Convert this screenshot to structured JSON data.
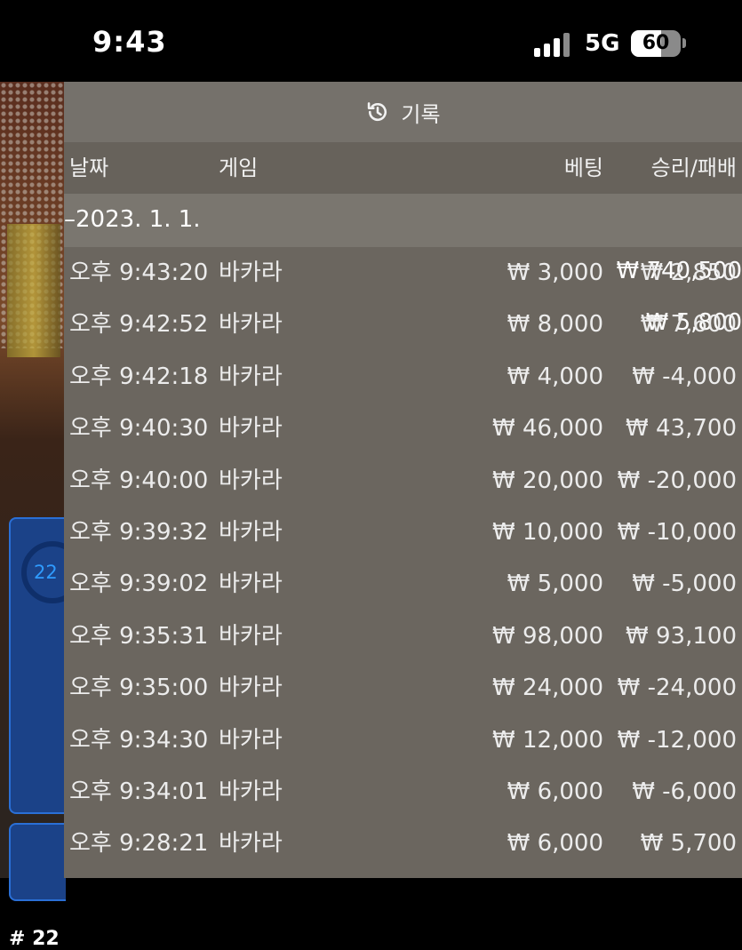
{
  "status_bar": {
    "time": "9:43",
    "network": "5G",
    "battery": "60",
    "battery_level": 0.6
  },
  "background_game": {
    "progress_text": "22",
    "table_number": "# 22"
  },
  "history": {
    "title": "기록",
    "columns": {
      "date": "날짜",
      "game": "게임",
      "bet": "베팅",
      "win_loss": "승리/패배"
    },
    "summary": {
      "date": "–2023. 1. 1.",
      "bet": "₩ 740,500",
      "win_loss": "₩ 5,800"
    },
    "rows": [
      {
        "time": "오후 9:43:20",
        "game": "바카라",
        "bet": "₩ 3,000",
        "win_loss": "₩ 2,850"
      },
      {
        "time": "오후 9:42:52",
        "game": "바카라",
        "bet": "₩ 8,000",
        "win_loss": "₩ 7,600"
      },
      {
        "time": "오후 9:42:18",
        "game": "바카라",
        "bet": "₩ 4,000",
        "win_loss": "₩ -4,000"
      },
      {
        "time": "오후 9:40:30",
        "game": "바카라",
        "bet": "₩ 46,000",
        "win_loss": "₩ 43,700"
      },
      {
        "time": "오후 9:40:00",
        "game": "바카라",
        "bet": "₩ 20,000",
        "win_loss": "₩ -20,000"
      },
      {
        "time": "오후 9:39:32",
        "game": "바카라",
        "bet": "₩ 10,000",
        "win_loss": "₩ -10,000"
      },
      {
        "time": "오후 9:39:02",
        "game": "바카라",
        "bet": "₩ 5,000",
        "win_loss": "₩ -5,000"
      },
      {
        "time": "오후 9:35:31",
        "game": "바카라",
        "bet": "₩ 98,000",
        "win_loss": "₩ 93,100"
      },
      {
        "time": "오후 9:35:00",
        "game": "바카라",
        "bet": "₩ 24,000",
        "win_loss": "₩ -24,000"
      },
      {
        "time": "오후 9:34:30",
        "game": "바카라",
        "bet": "₩ 12,000",
        "win_loss": "₩ -12,000"
      },
      {
        "time": "오후 9:34:01",
        "game": "바카라",
        "bet": "₩ 6,000",
        "win_loss": "₩ -6,000"
      },
      {
        "time": "오후 9:28:21",
        "game": "바카라",
        "bet": "₩ 6,000",
        "win_loss": "₩ 5,700"
      }
    ]
  }
}
